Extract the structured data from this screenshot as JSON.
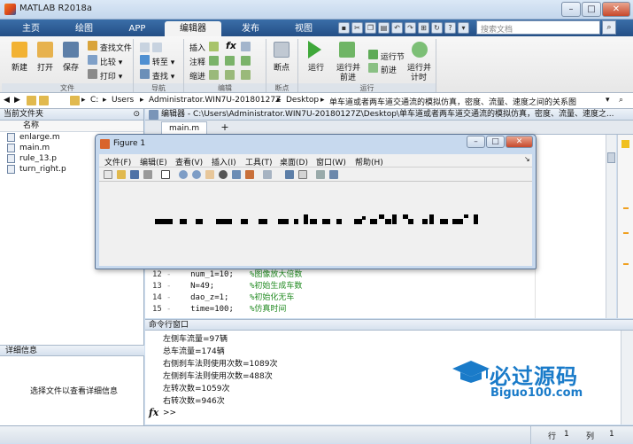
{
  "window": {
    "title": "MATLAB R2018a",
    "minimize": "–",
    "maximize": "□",
    "close": "✕"
  },
  "tabs": [
    "主页",
    "绘图",
    "APP",
    "编辑器",
    "发布",
    "视图"
  ],
  "search": {
    "placeholder": "搜索文档"
  },
  "ribbon": {
    "file": {
      "new": "新建",
      "open": "打开",
      "save": "保存",
      "find_files": "查找文件",
      "compare": "比较",
      "print": "打印",
      "group": "文件"
    },
    "nav": {
      "goto": "转至",
      "find": "查找",
      "group": "导航"
    },
    "edit": {
      "insert": "插入",
      "fx": "fx",
      "comment": "注释",
      "indent": "缩进",
      "group": "编辑"
    },
    "breakpoints": {
      "label": "断点",
      "group": "断点"
    },
    "run": {
      "run": "运行",
      "run_advance_1": "运行并",
      "run_advance_2": "前进",
      "run_section": "运行节",
      "advance": "前进",
      "run_time_1": "运行并",
      "run_time_2": "计时",
      "group": "运行"
    }
  },
  "path": [
    "C:",
    "Users",
    "Administrator.WIN7U-20180127Z",
    "Desktop",
    "单车道或者两车道交通流的模拟仿真，密度、流量、速度之间的关系图"
  ],
  "current_folder": {
    "title": "当前文件夹",
    "column": "名称",
    "files": [
      "enlarge.m",
      "main.m",
      "rule_13.p",
      "turn_right.p"
    ]
  },
  "details": {
    "title": "详细信息",
    "hint": "选择文件以查看详细信息"
  },
  "editor": {
    "header": "编辑器 - C:\\Users\\Administrator.WIN7U-20180127Z\\Desktop\\单车道或者两车道交通流的模拟仿真，密度、流量、速度之...",
    "tab": "main.m",
    "add_tab": "+",
    "lines": [
      {
        "num": "12",
        "code": "num_1=10;",
        "comment": "%图像放大倍数"
      },
      {
        "num": "13",
        "code": "N=49;",
        "comment": "%初始生成车数"
      },
      {
        "num": "14",
        "code": "dao_z=1;",
        "comment": "%初始化无车"
      },
      {
        "num": "15",
        "code": "time=100;",
        "comment": "%仿真时间"
      }
    ]
  },
  "command_window": {
    "title": "命令行窗口",
    "lines": [
      "左侧车流量=97辆",
      "总车流量=174辆",
      "右侧刹车法则使用次数=1089次",
      "左侧刹车法则使用次数=488次",
      "左转次数=1059次",
      "右转次数=946次"
    ],
    "fx": "fx",
    "prompt": ">>"
  },
  "figure": {
    "title": "Figure 1",
    "menu": [
      "文件(F)",
      "编辑(E)",
      "查看(V)",
      "插入(I)",
      "工具(T)",
      "桌面(D)",
      "窗口(W)",
      "帮助(H)"
    ]
  },
  "status": {
    "row_label": "行",
    "row": "1",
    "col_label": "列",
    "col": "1"
  },
  "watermark": {
    "title": "必过源码",
    "sub": "Biguo100.com"
  },
  "colors": {
    "tab_bar": "#2d5c96",
    "comment": "#228b22",
    "watermark": "#1a7bc9"
  }
}
